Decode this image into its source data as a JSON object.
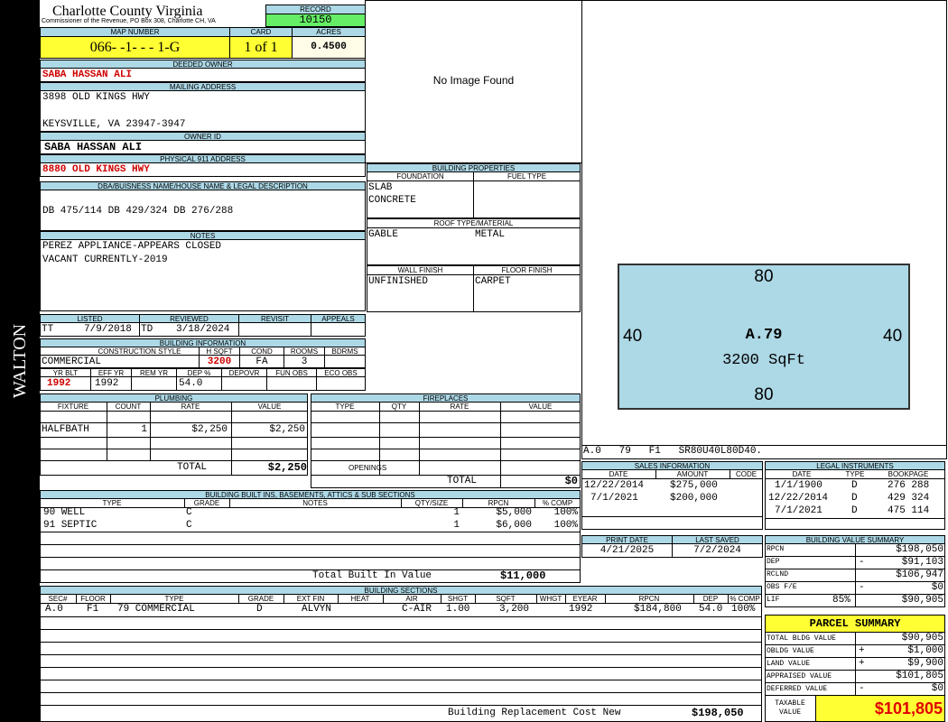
{
  "side_label": "WALTON",
  "county": {
    "title": "Charlotte County Virginia",
    "subtitle": "Commissioner of the Revenue, PO Box 308, Charlotte CH, VA"
  },
  "record": {
    "label": "RECORD",
    "value": "10150"
  },
  "map": {
    "label": "MAP NUMBER",
    "value": "066- -1- - - 1-G"
  },
  "card": {
    "label": "CARD",
    "value": "1 of 1"
  },
  "acres": {
    "label": "ACRES",
    "value": "0.4500"
  },
  "deeded_owner": {
    "label": "DEEDED OWNER",
    "value": "SABA HASSAN ALI"
  },
  "mailing": {
    "label": "MAILING ADDRESS",
    "line1": "3898 OLD KINGS HWY",
    "line2": "KEYSVILLE, VA 23947-3947"
  },
  "owner_id": {
    "label": "OWNER ID",
    "value": "SABA HASSAN ALI"
  },
  "physical": {
    "label": "PHYSICAL 911 ADDRESS",
    "value": "8880 OLD KINGS HWY"
  },
  "dba": {
    "label": "DBA/BUISNESS NAME/HOUSE NAME & LEGAL DESCRIPTION",
    "value": "DB 475/114 DB 429/324 DB 276/288"
  },
  "notes": {
    "label": "NOTES",
    "line1": "PEREZ APPLIANCE-APPEARS CLOSED",
    "line2": "VACANT CURRENTLY-2019"
  },
  "image": {
    "text": "No Image Found"
  },
  "building_props": {
    "label": "BUILDING PROPERTIES",
    "foundation_label": "FOUNDATION",
    "fuel_label": "FUEL TYPE",
    "foundation1": "SLAB",
    "foundation2": "CONCRETE",
    "roof_label": "ROOF TYPE/MATERIAL",
    "roof_type": "GABLE",
    "roof_material": "METAL",
    "wall_label": "WALL FINISH",
    "floor_label": "FLOOR FINISH",
    "wall": "UNFINISHED",
    "floor": "CARPET"
  },
  "listed": {
    "listed_label": "LISTED",
    "reviewed_label": "REVIEWED",
    "revisit_label": "REVISIT",
    "appeals_label": "APPEALS",
    "listed_by": "TT",
    "listed_date": "7/9/2018",
    "reviewed_by": "TD",
    "reviewed_date": "3/18/2024"
  },
  "bldg_info": {
    "label": "BUILDING INFORMATION",
    "style_label": "CONSTRUCTION STYLE",
    "hsqft_label": "H SQFT",
    "cond_label": "COND",
    "rooms_label": "ROOMS",
    "bdrms_label": "BDRMS",
    "style": "COMMERCIAL",
    "hsqft": "3200",
    "cond": "FA",
    "rooms": "3",
    "yrblt_label": "YR BLT",
    "effyr_label": "EFF YR",
    "remyr_label": "REM YR",
    "dep_label": "DEP %",
    "depovr_label": "DEPOVR",
    "funobs_label": "FUN OBS",
    "ecoobs_label": "ECO OBS",
    "yrblt": "1992",
    "effyr": "1992",
    "dep": "54.0"
  },
  "plumbing": {
    "label": "PLUMBING",
    "cols": [
      "FIXTURE",
      "COUNT",
      "RATE",
      "VALUE"
    ],
    "fixture": "HALFBATH",
    "count": "1",
    "rate": "$2,250",
    "value": "$2,250",
    "total_label": "TOTAL",
    "total": "$2,250"
  },
  "fireplaces": {
    "label": "FIREPLACES",
    "cols": [
      "TYPE",
      "QTY",
      "RATE",
      "VALUE"
    ],
    "openings_label": "OPENINGS",
    "total_label": "TOTAL",
    "total": "$0"
  },
  "sketch": {
    "top": "80",
    "bottom": "80",
    "left": "40",
    "right": "40",
    "area_code": "A.79",
    "sqft": "3200 SqFt",
    "code_line": "A.0   79   F1   SR80U40L80D40."
  },
  "sales": {
    "label": "SALES INFORMATION",
    "cols": [
      "DATE",
      "AMOUNT",
      "CODE"
    ],
    "rows": [
      {
        "date": "12/22/2014",
        "amount": "$275,000"
      },
      {
        "date": "7/1/2021",
        "amount": "$200,000"
      }
    ]
  },
  "legal": {
    "label": "LEGAL INSTRUMENTS",
    "cols": [
      "DATE",
      "TYPE",
      "BOOKPAGE"
    ],
    "rows": [
      {
        "date": "1/1/1900",
        "type": "D",
        "book": "276 288"
      },
      {
        "date": "12/22/2014",
        "type": "D",
        "book": "429 324"
      },
      {
        "date": "7/1/2021",
        "type": "D",
        "book": "475 114"
      }
    ]
  },
  "print": {
    "print_label": "PRINT DATE",
    "saved_label": "LAST SAVED",
    "print_date": "4/21/2025",
    "saved_date": "7/2/2024"
  },
  "builtins": {
    "label": "BUILDING BUILT INS, BASEMENTS, ATTICS & SUB SECTIONS",
    "cols": [
      "TYPE",
      "GRADE",
      "NOTES",
      "QTY/SIZE",
      "RPCN",
      "% COMP"
    ],
    "rows": [
      {
        "type": "90 WELL",
        "grade": "C",
        "qty": "1",
        "rpcn": "$5,000",
        "comp": "100%"
      },
      {
        "type": "91 SEPTIC",
        "grade": "C",
        "qty": "1",
        "rpcn": "$6,000",
        "comp": "100%"
      }
    ],
    "total_label": "Total Built In Value",
    "total": "$11,000"
  },
  "bvs": {
    "label": "BUILDING VALUE SUMMARY",
    "rows": [
      {
        "label": "RPCN",
        "op": "",
        "value": "$198,050"
      },
      {
        "label": "DEP",
        "op": "-",
        "value": "$91,103"
      },
      {
        "label": "RCLND",
        "op": "",
        "value": "$106,947"
      },
      {
        "label": "OBS F/E",
        "op": "-",
        "value": "$0"
      },
      {
        "label": "LIF",
        "op": "85%",
        "value": "$90,905"
      }
    ]
  },
  "parcel": {
    "label": "PARCEL SUMMARY",
    "rows": [
      {
        "label": "TOTAL BLDG VALUE",
        "op": "",
        "value": "$90,905"
      },
      {
        "label": "OBLDG VALUE",
        "op": "+",
        "value": "$1,000"
      },
      {
        "label": "LAND VALUE",
        "op": "+",
        "value": "$9,900"
      },
      {
        "label": "APPRAISED VALUE",
        "op": "",
        "value": "$101,805"
      },
      {
        "label": "DEFERRED VALUE",
        "op": "-",
        "value": "$0"
      }
    ],
    "taxable_label1": "TAXABLE",
    "taxable_label2": "VALUE",
    "taxable": "$101,805"
  },
  "sections": {
    "label": "BUILDING SECTIONS",
    "cols": [
      "SEC#",
      "FLOOR",
      "TYPE",
      "GRADE",
      "EXT FIN",
      "HEAT",
      "AIR",
      "SHGT",
      "SQFT",
      "WHGT",
      "EYEAR",
      "RPCN",
      "DEP",
      "% COMP"
    ],
    "row": {
      "sec": "A.0",
      "floor": "F1",
      "type": "79 COMMERCIAL",
      "grade": "D",
      "ext": "ALVYN",
      "heat": "",
      "air": "C-AIR",
      "shgt": "1.00",
      "sqft": "3,200",
      "whgt": "",
      "eyear": "1992",
      "rpcn": "$184,800",
      "dep": "54.0",
      "comp": "100%"
    },
    "replacement_label": "Building Replacement Cost New",
    "replacement": "$198,050"
  }
}
